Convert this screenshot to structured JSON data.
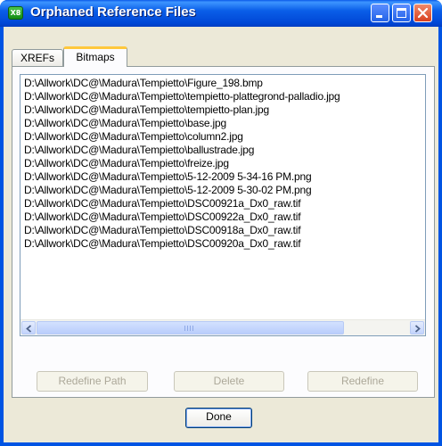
{
  "window": {
    "title": "Orphaned Reference Files",
    "app_icon_text": "X8"
  },
  "tabs": [
    {
      "label": "XREFs",
      "selected": false
    },
    {
      "label": "Bitmaps",
      "selected": true
    }
  ],
  "file_list": {
    "items": [
      "D:\\Allwork\\DC@\\Madura\\Tempietto\\Figure_198.bmp",
      "D:\\Allwork\\DC@\\Madura\\Tempietto\\tempietto-plattegrond-palladio.jpg",
      "D:\\Allwork\\DC@\\Madura\\Tempietto\\tempietto-plan.jpg",
      "D:\\Allwork\\DC@\\Madura\\Tempietto\\base.jpg",
      "D:\\Allwork\\DC@\\Madura\\Tempietto\\column2.jpg",
      "D:\\Allwork\\DC@\\Madura\\Tempietto\\ballustrade.jpg",
      "D:\\Allwork\\DC@\\Madura\\Tempietto\\freize.jpg",
      "D:\\Allwork\\DC@\\Madura\\Tempietto\\5-12-2009 5-34-16 PM.png",
      "D:\\Allwork\\DC@\\Madura\\Tempietto\\5-12-2009 5-30-02 PM.png",
      "D:\\Allwork\\DC@\\Madura\\Tempietto\\DSC00921a_Dx0_raw.tif",
      "D:\\Allwork\\DC@\\Madura\\Tempietto\\DSC00922a_Dx0_raw.tif",
      "D:\\Allwork\\DC@\\Madura\\Tempietto\\DSC00918a_Dx0_raw.tif",
      "D:\\Allwork\\DC@\\Madura\\Tempietto\\DSC00920a_Dx0_raw.tif"
    ]
  },
  "actions": {
    "redefine_path": "Redefine Path",
    "delete": "Delete",
    "redefine": "Redefine",
    "done": "Done"
  },
  "colors": {
    "title_bar": "#0054e3",
    "selected_tab_accent": "#ffc83c",
    "close_button": "#d8401f"
  }
}
